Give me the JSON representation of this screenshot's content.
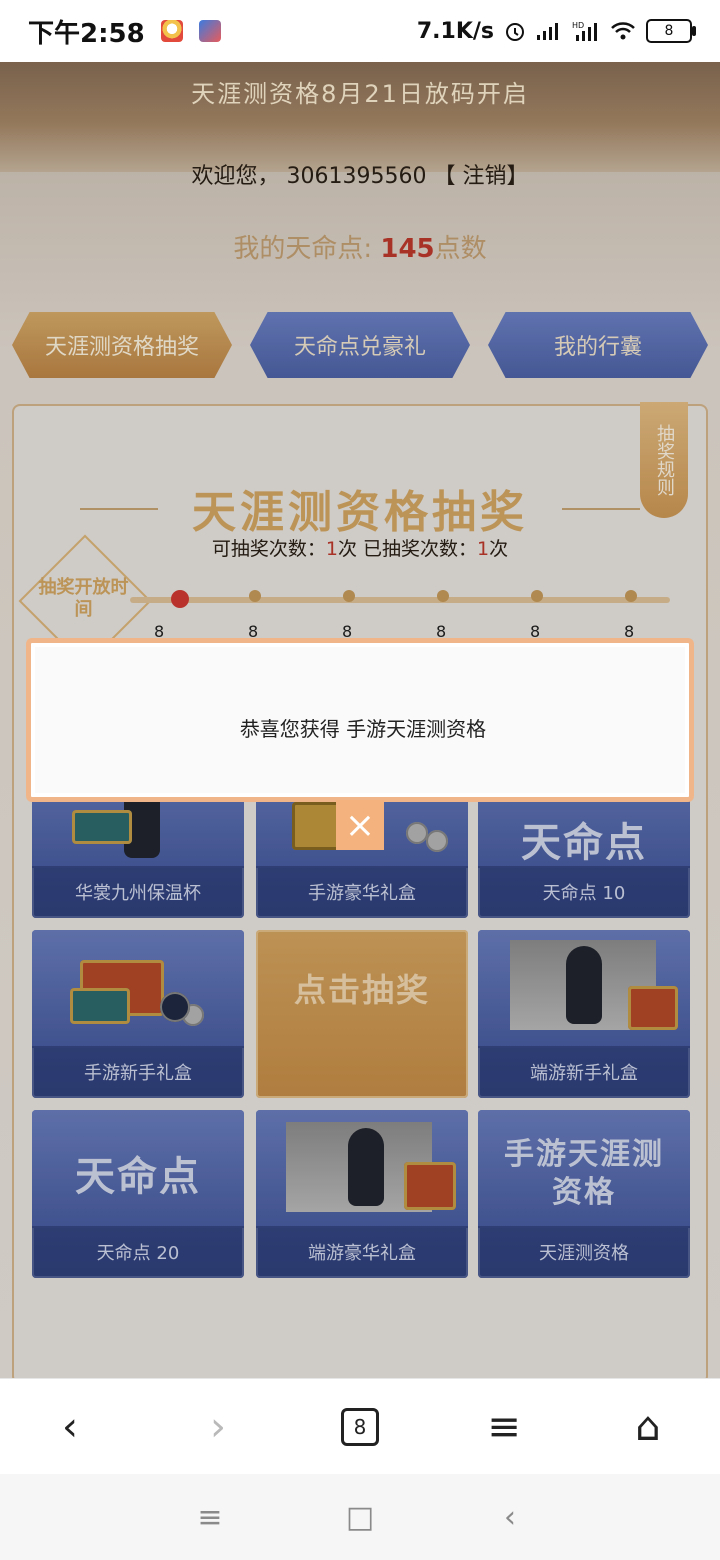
{
  "status_bar": {
    "time": "下午2:58",
    "network_speed": "7.1K/s",
    "battery": "8",
    "icons": [
      "qq-icon",
      "app-icon",
      "alarm-icon",
      "signal-icon",
      "hd-signal-icon",
      "wifi-icon",
      "battery-icon"
    ]
  },
  "hero": {
    "title": "天涯测资格8月21日放码开启"
  },
  "welcome": {
    "prefix": "欢迎您，",
    "user_id": "3061395560",
    "logout": "【 注销】"
  },
  "points": {
    "label": "我的天命点:",
    "value": "145",
    "unit": "点数"
  },
  "tabs": [
    {
      "label": "天涯测资格抽奖",
      "active": true
    },
    {
      "label": "天命点兑豪礼",
      "active": false
    },
    {
      "label": "我的行囊",
      "active": false
    }
  ],
  "rules_tag": "抽奖规则",
  "section": {
    "title": "天涯测资格抽奖",
    "available_label": "可抽奖次数：",
    "available_value": "1",
    "available_unit": "次",
    "used_label": "已抽奖次数：",
    "used_value": "1",
    "used_unit": "次"
  },
  "timeline": {
    "open_time_label": "抽奖开放时间",
    "marks": [
      "8",
      "8",
      "8",
      "8",
      "8",
      "8"
    ]
  },
  "prizes": [
    {
      "label": "华裳九州保温杯"
    },
    {
      "label": "手游豪华礼盒"
    },
    {
      "label": "天命点 10",
      "art_text": "天命点"
    },
    {
      "label": "手游新手礼盒"
    },
    {
      "label": "",
      "art_text": "点击抽奖"
    },
    {
      "label": "端游新手礼盒"
    },
    {
      "label": "天命点 20",
      "art_text": "天命点"
    },
    {
      "label": "端游豪华礼盒"
    },
    {
      "label": "天涯测资格",
      "art_text": "手游天涯测资格"
    }
  ],
  "modal": {
    "message": "恭喜您获得 手游天涯测资格",
    "close": "×"
  },
  "toolbar": {
    "back": "‹",
    "forward": "›",
    "tabs_count": "8",
    "menu": "≡",
    "home": "⌂"
  },
  "navbar": {
    "recent": "≡",
    "home": "□",
    "back": "‹"
  }
}
